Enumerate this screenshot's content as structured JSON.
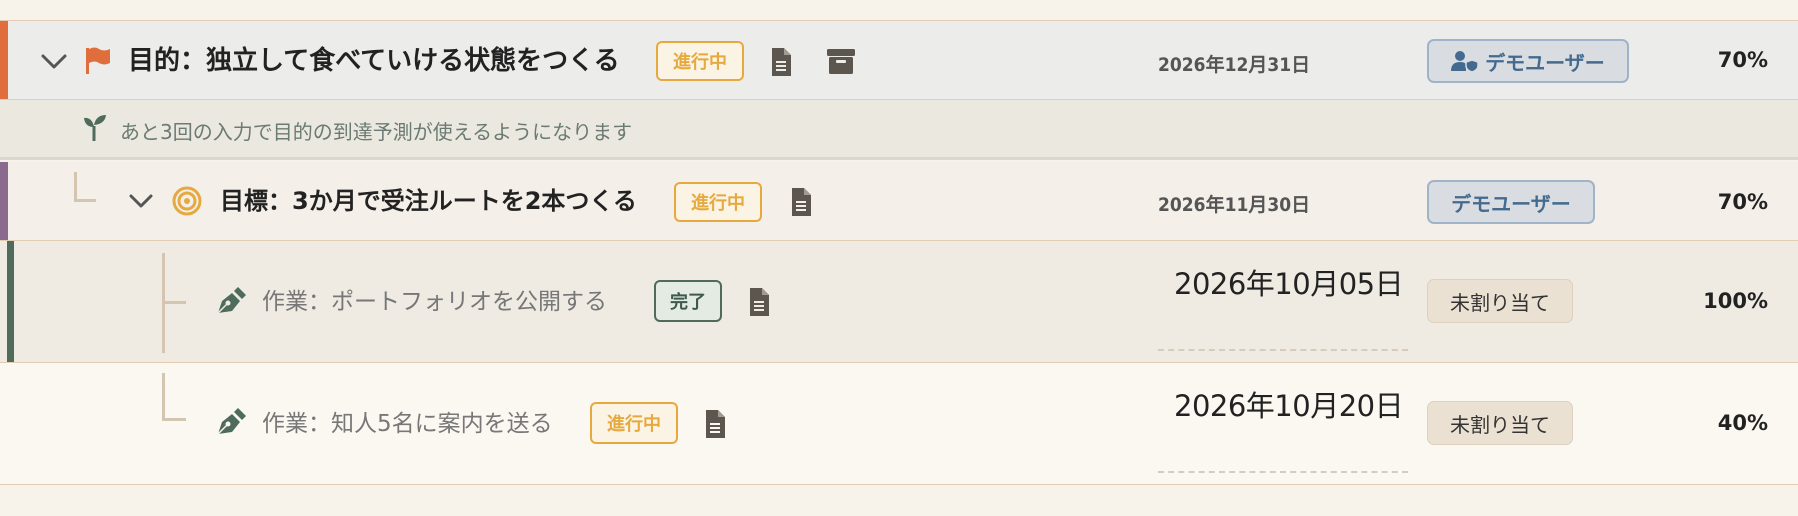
{
  "colors": {
    "purpose_accent": "#e06e3c",
    "goal_accent": "#8a6b8f",
    "task_accent": "#4f6b5c",
    "progress": "#e6a93f",
    "done": "#4f6b5c",
    "assigned": "#446a8f"
  },
  "purpose": {
    "title": "目的：独立して食べていける状態をつくる",
    "status": "進行中",
    "date": "2026年12月31日",
    "assignee": "デモユーザー",
    "percent": "70%",
    "icons": [
      "chevron-down-icon",
      "flag-icon",
      "document-icon",
      "archive-icon",
      "user-shield-icon"
    ]
  },
  "hint": {
    "text": "あと3回の入力で目的の到達予測が使えるようになります",
    "icon": "sprout-icon"
  },
  "goal": {
    "title": "目標：3か月で受注ルートを2本つくる",
    "status": "進行中",
    "date": "2026年11月30日",
    "assignee": "デモユーザー",
    "percent": "70%",
    "icons": [
      "chevron-down-icon",
      "target-icon",
      "document-icon"
    ]
  },
  "tasks": [
    {
      "title": "作業：ポートフォリオを公開する",
      "status": "完了",
      "date": "2026年10月05日",
      "assignee": "未割り当て",
      "percent": "100%",
      "icons": [
        "pen-icon",
        "document-icon"
      ]
    },
    {
      "title": "作業：知人5名に案内を送る",
      "status": "進行中",
      "date": "2026年10月20日",
      "assignee": "未割り当て",
      "percent": "40%",
      "icons": [
        "pen-icon",
        "document-icon"
      ]
    }
  ]
}
